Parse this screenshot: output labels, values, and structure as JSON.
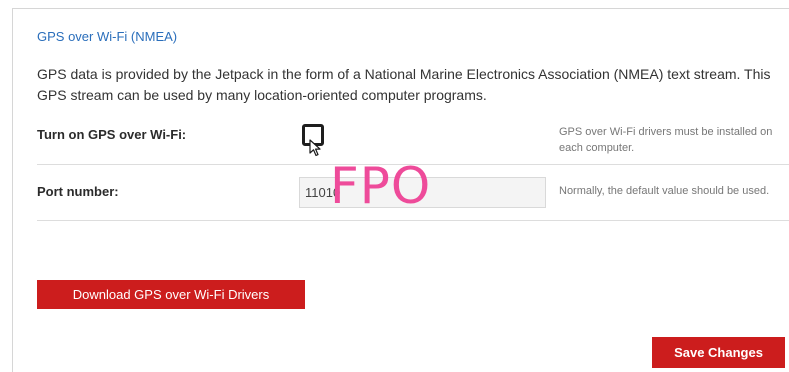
{
  "section": {
    "title": "GPS over Wi-Fi (NMEA)",
    "description": "GPS data is provided by the Jetpack in the form of a National Marine Electronics Association (NMEA) text stream. This GPS stream can be used by many location-oriented computer programs."
  },
  "gps_toggle": {
    "label": "Turn on GPS over Wi-Fi:",
    "checked": false,
    "help": "GPS over Wi-Fi drivers must be installed on each computer."
  },
  "port": {
    "label": "Port number:",
    "value": "11010",
    "help": "Normally, the default value should be used."
  },
  "overlay": {
    "text": "FPO",
    "color": "#ee4b9a"
  },
  "buttons": {
    "download_label": "Download GPS over Wi-Fi Drivers",
    "save_label": "Save Changes"
  },
  "colors": {
    "accent_red": "#cc1d1d",
    "title_blue": "#2a6ebb"
  },
  "icons": {
    "cursor": "mouse-pointer-icon"
  }
}
